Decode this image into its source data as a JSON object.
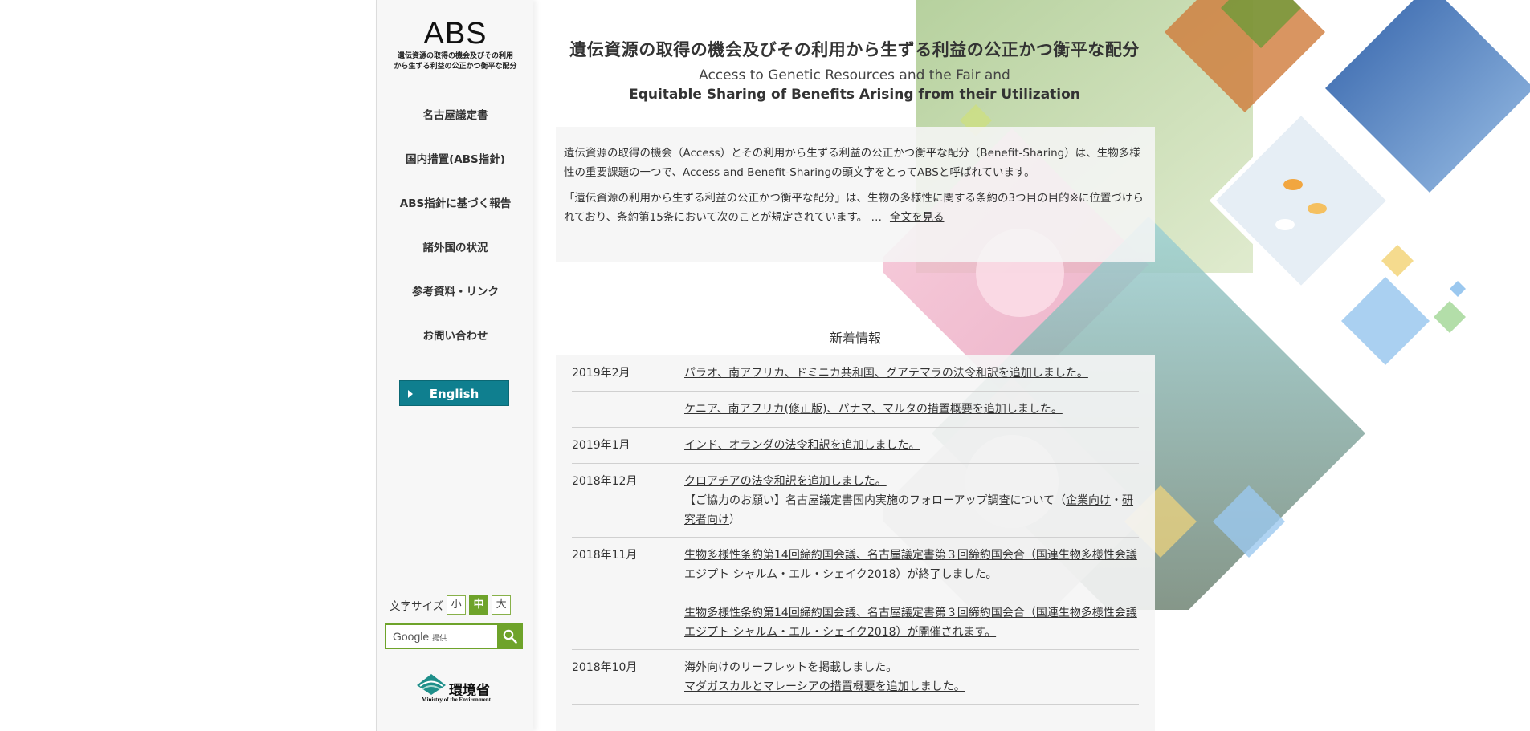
{
  "sidebar": {
    "logo_title": "ABS",
    "logo_subtitle_1": "遺伝資源の取得の機会及びその利用",
    "logo_subtitle_2": "から生ずる利益の公正かつ衡平な配分",
    "nav": [
      {
        "label": "名古屋議定書"
      },
      {
        "label": "国内措置(ABS指針)"
      },
      {
        "label": "ABS指針に基づく報告"
      },
      {
        "label": "諸外国の状況"
      },
      {
        "label": "参考資料・リンク"
      },
      {
        "label": "お問い合わせ"
      }
    ],
    "english_label": "English",
    "fontsize_label": "文字サイズ",
    "fontsize_small": "小",
    "fontsize_medium": "中",
    "fontsize_large": "大",
    "search_brand": "Google",
    "search_provided": "提供",
    "ministry_jp": "環境省",
    "ministry_en": "Ministry of the Environment",
    "colors": {
      "english_bg": "#0f7f8f",
      "accent_green": "#6ea32a"
    }
  },
  "main": {
    "title": "遺伝資源の取得の機会及びその利用から生ずる利益の公正かつ衡平な配分",
    "subtitle_1": "Access to Genetic Resources and the Fair and",
    "subtitle_2": "Equitable Sharing of Benefits Arising from their Utilization",
    "intro_p1": "遺伝資源の取得の機会（Access）とその利用から生ずる利益の公正かつ衡平な配分（Benefit-Sharing）は、生物多様性の重要課題の一つで、Access and Benefit-Sharingの頭文字をとってABSと呼ばれています。",
    "intro_p2": "「遺伝資源の利用から生ずる利益の公正かつ衡平な配分」は、生物の多様性に関する条約の3つ目の目的※に位置づけられており、条約第15条において次のことが規定されています。 …",
    "intro_more": "全文を見る",
    "news_heading": "新着情報",
    "news": [
      {
        "date": "2019年2月",
        "items": [
          {
            "text": "パラオ、南アフリカ、ドミニカ共和国、グアテマラの法令和訳を追加しました。"
          }
        ]
      },
      {
        "date": "",
        "items": [
          {
            "text": "ケニア、南アフリカ(修正版)、パナマ、マルタの措置概要を追加しました。"
          }
        ]
      },
      {
        "date": "2019年1月",
        "items": [
          {
            "text": "インド、オランダの法令和訳を追加しました。"
          }
        ]
      },
      {
        "date": "2018年12月",
        "items": [
          {
            "text": "クロアチアの法令和訳を追加しました。"
          }
        ]
      },
      {
        "date": "2018年11月",
        "items": [
          {
            "text": "生物多様性条約第14回締約国会議、名古屋議定書第３回締約国会合（国連生物多様性会議エジプト シャルム・エル・シェイク2018）が終了しました。"
          },
          {
            "text": "生物多様性条約第14回締約国会議、名古屋議定書第３回締約国会合（国連生物多様性会議エジプト シャルム・エル・シェイク2018）が開催されます。"
          }
        ]
      },
      {
        "date": "2018年10月",
        "items": [
          {
            "text": "海外向けのリーフレットを掲載しました。"
          },
          {
            "text": "マダガスカルとマレーシアの措置概要を追加しました。"
          }
        ]
      }
    ],
    "dec_2018_notice_prefix": "【ご協力のお願い】名古屋議定書国内実施のフォローアップ調査について（",
    "dec_2018_notice_link1": "企業向け",
    "dec_2018_notice_sep": "・",
    "dec_2018_notice_link2": "研究者向け",
    "dec_2018_notice_suffix": "）"
  }
}
